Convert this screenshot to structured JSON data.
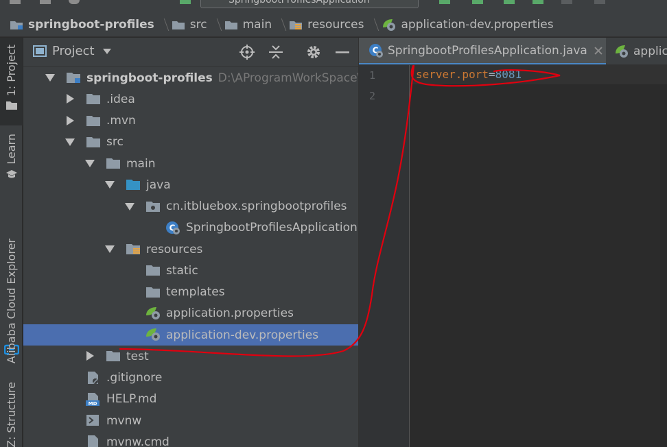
{
  "toolbar": {
    "run_config": "SpringbootProfilesApplication"
  },
  "breadcrumb": [
    {
      "label": "springboot-profiles",
      "icon": "module-folder-icon"
    },
    {
      "label": "src",
      "icon": "folder-icon"
    },
    {
      "label": "main",
      "icon": "folder-icon"
    },
    {
      "label": "resources",
      "icon": "resources-folder-icon"
    },
    {
      "label": "application-dev.properties",
      "icon": "spring-properties-icon"
    }
  ],
  "left_stripe": {
    "project": "1: Project",
    "learn": "Learn",
    "alibaba": "Alibaba Cloud Explorer",
    "structure": "Z: Structure"
  },
  "project_panel": {
    "title": "Project",
    "tree": [
      {
        "label": "springboot-profiles",
        "path": "D:\\AProgramWorkSpace\\idea\\s",
        "depth": 0,
        "arrow": "down",
        "icon": "module-folder-icon",
        "bold": true
      },
      {
        "label": ".idea",
        "depth": 1,
        "arrow": "right",
        "icon": "folder-icon"
      },
      {
        "label": ".mvn",
        "depth": 1,
        "arrow": "right",
        "icon": "folder-icon"
      },
      {
        "label": "src",
        "depth": 1,
        "arrow": "down",
        "icon": "folder-icon"
      },
      {
        "label": "main",
        "depth": 2,
        "arrow": "down",
        "icon": "folder-icon"
      },
      {
        "label": "java",
        "depth": 3,
        "arrow": "down",
        "icon": "source-folder-icon"
      },
      {
        "label": "cn.itbluebox.springbootprofiles",
        "depth": 4,
        "arrow": "down",
        "icon": "package-icon"
      },
      {
        "label": "SpringbootProfilesApplication",
        "depth": 5,
        "arrow": "none",
        "icon": "spring-class-icon"
      },
      {
        "label": "resources",
        "depth": 3,
        "arrow": "down",
        "icon": "resources-folder-icon"
      },
      {
        "label": "static",
        "depth": 4,
        "arrow": "none",
        "icon": "folder-icon"
      },
      {
        "label": "templates",
        "depth": 4,
        "arrow": "none",
        "icon": "folder-icon"
      },
      {
        "label": "application.properties",
        "depth": 4,
        "arrow": "none",
        "icon": "spring-properties-icon"
      },
      {
        "label": "application-dev.properties",
        "depth": 4,
        "arrow": "none",
        "icon": "spring-properties-icon",
        "selected": true
      },
      {
        "label": "test",
        "depth": 2,
        "arrow": "right",
        "icon": "folder-icon"
      },
      {
        "label": ".gitignore",
        "depth": 1,
        "arrow": "none",
        "icon": "gitignore-file-icon"
      },
      {
        "label": "HELP.md",
        "depth": 1,
        "arrow": "none",
        "icon": "markdown-file-icon"
      },
      {
        "label": "mvnw",
        "depth": 1,
        "arrow": "none",
        "icon": "shell-file-icon"
      },
      {
        "label": "mvnw.cmd",
        "depth": 1,
        "arrow": "none",
        "icon": "file-icon"
      }
    ]
  },
  "editor": {
    "tabs": [
      {
        "label": "SpringbootProfilesApplication.java",
        "icon": "spring-class-icon",
        "active": true
      },
      {
        "label": "applic",
        "icon": "spring-properties-icon",
        "active": false
      }
    ],
    "lines": [
      {
        "number": "1",
        "key": "server.port",
        "eq": "=",
        "value": "8081"
      },
      {
        "number": "2",
        "key": "",
        "eq": "",
        "value": ""
      }
    ]
  },
  "colors": {
    "background": "#2b2b2b",
    "panel": "#3c3f41",
    "selection": "#4b6eaf",
    "key": "#cc7832",
    "number": "#6897bb",
    "annotation": "#e0000f"
  }
}
